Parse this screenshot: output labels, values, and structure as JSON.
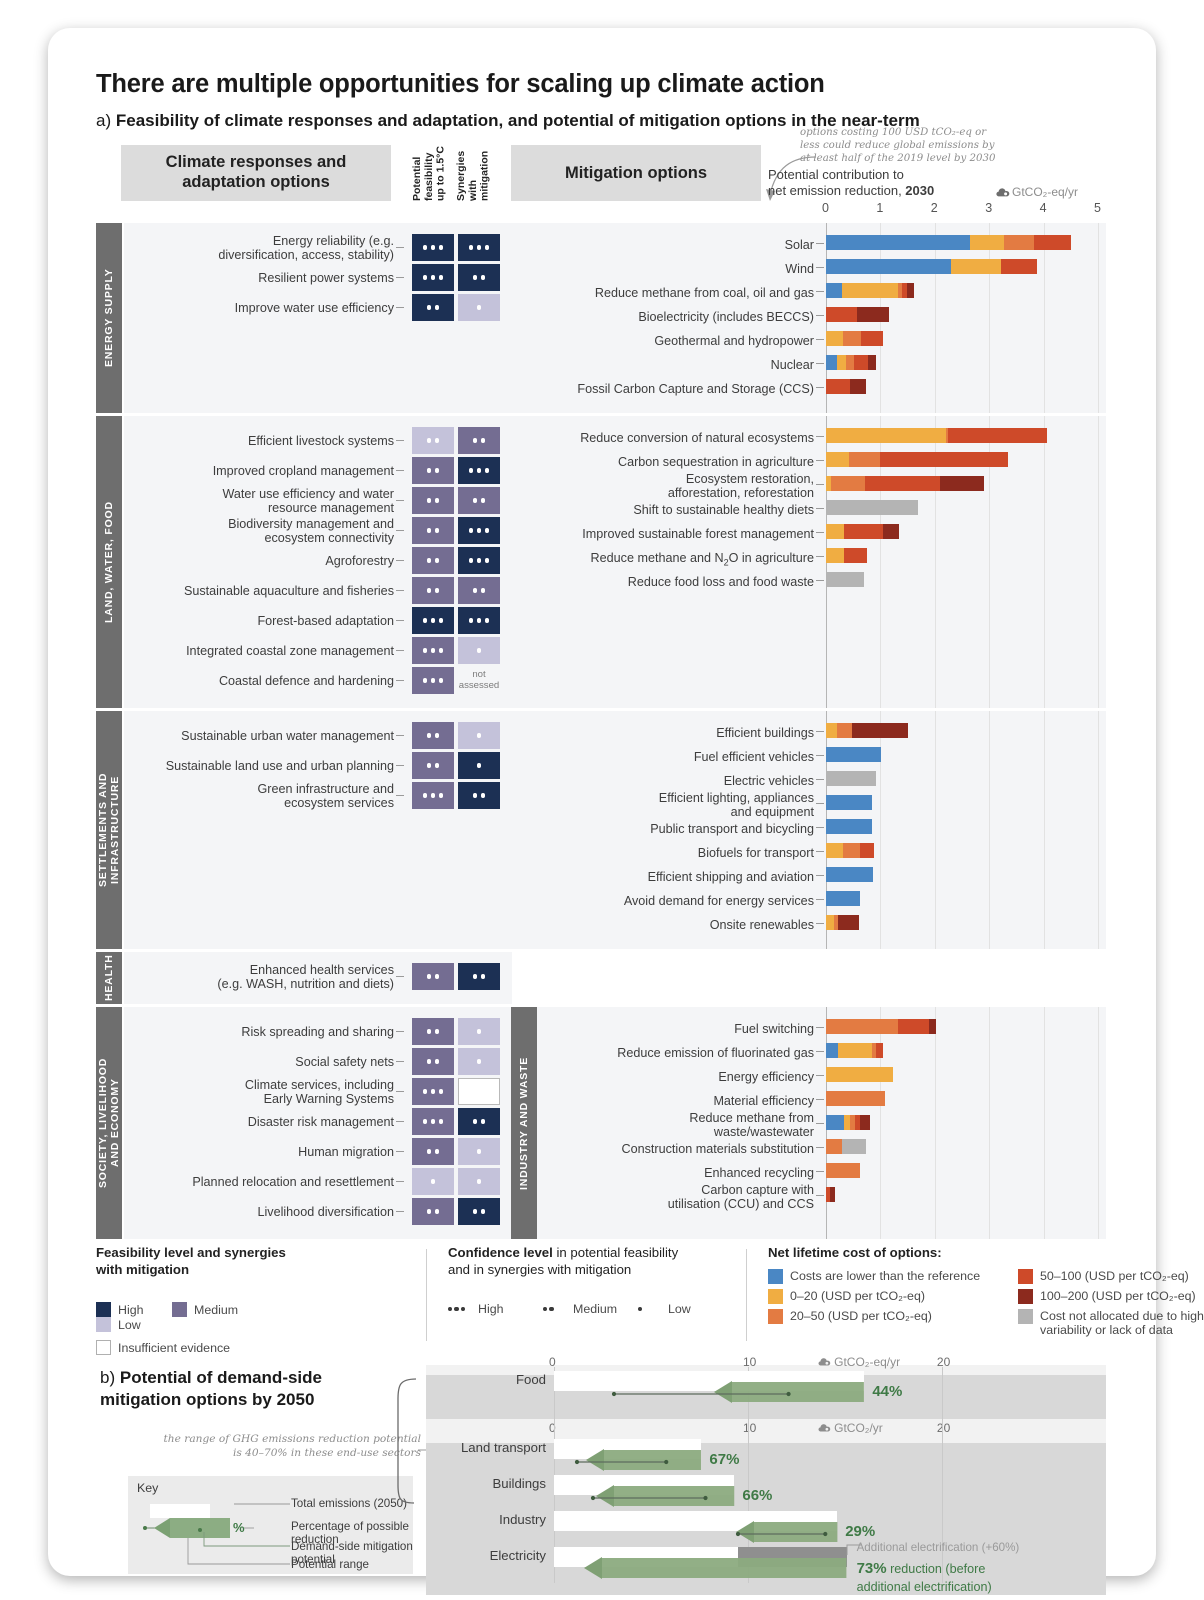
{
  "title": "There are multiple opportunities for scaling up climate action",
  "panel_a": {
    "letter": "a)",
    "subtitle": "Feasibility of climate responses and adaptation, and potential of mitigation options in the near-term",
    "header_left": "Climate responses and\nadaptation options",
    "col1": "Potential\nfeasibility\nup to 1.5°C",
    "col2": "Synergies\nwith\nmitigation",
    "header_mid": "Mitigation options",
    "callout_note": "options costing 100 USD tCO₂-eq or\nless could reduce global emissions by\nat least half of the 2019 level by 2030",
    "axis_title_line1": "Potential contribution to",
    "axis_title_line2a": "net emission reduction, ",
    "axis_title_line2b": "2030",
    "unit": "GtCO₂-eq/yr",
    "axis_ticks": [
      "0",
      "1",
      "2",
      "3",
      "4",
      "5"
    ],
    "axis_max": 5
  },
  "sections": [
    {
      "tab": "ENERGY SUPPLY",
      "adaptation": [
        {
          "label": "Energy reliability (e.g.\ndiversification, access, stability)",
          "feasibility": "high",
          "fdots": 3,
          "synergy": "high",
          "sdots": 3
        },
        {
          "label": "Resilient power systems",
          "feasibility": "high",
          "fdots": 3,
          "synergy": "high",
          "sdots": 2
        },
        {
          "label": "Improve water use efficiency",
          "feasibility": "high",
          "fdots": 2,
          "synergy": "low",
          "sdots": 1
        }
      ],
      "mitigation": [
        {
          "label": "Solar",
          "segments": [
            {
              "cost": "lower",
              "v": 2.65
            },
            {
              "cost": "0-20",
              "v": 0.62
            },
            {
              "cost": "20-50",
              "v": 0.55
            },
            {
              "cost": "50-100",
              "v": 0.68
            }
          ]
        },
        {
          "label": "Wind",
          "segments": [
            {
              "cost": "lower",
              "v": 2.3
            },
            {
              "cost": "0-20",
              "v": 0.92
            },
            {
              "cost": "20-50",
              "v": 0.0
            },
            {
              "cost": "50-100",
              "v": 0.66
            }
          ]
        },
        {
          "label": "Reduce methane from coal, oil and gas",
          "segments": [
            {
              "cost": "lower",
              "v": 0.3
            },
            {
              "cost": "0-20",
              "v": 1.02
            },
            {
              "cost": "20-50",
              "v": 0.07
            },
            {
              "cost": "50-100",
              "v": 0.1
            },
            {
              "cost": "100-200",
              "v": 0.12
            }
          ]
        },
        {
          "label": "Bioelectricity (includes BECCS)",
          "segments": [
            {
              "cost": "50-100",
              "v": 0.57
            },
            {
              "cost": "100-200",
              "v": 0.58
            }
          ]
        },
        {
          "label": "Geothermal and hydropower",
          "segments": [
            {
              "cost": "0-20",
              "v": 0.32
            },
            {
              "cost": "20-50",
              "v": 0.33
            },
            {
              "cost": "50-100",
              "v": 0.4
            }
          ]
        },
        {
          "label": "Nuclear",
          "segments": [
            {
              "cost": "lower",
              "v": 0.2
            },
            {
              "cost": "0-20",
              "v": 0.16
            },
            {
              "cost": "20-50",
              "v": 0.15
            },
            {
              "cost": "50-100",
              "v": 0.27
            },
            {
              "cost": "100-200",
              "v": 0.14
            }
          ]
        },
        {
          "label": "Fossil Carbon Capture and Storage (CCS)",
          "segments": [
            {
              "cost": "50-100",
              "v": 0.45
            },
            {
              "cost": "100-200",
              "v": 0.28
            }
          ]
        }
      ]
    },
    {
      "tab": "LAND, WATER, FOOD",
      "adaptation": [
        {
          "label": "Efficient livestock systems",
          "feasibility": "low",
          "fdots": 2,
          "synergy": "medium",
          "sdots": 2
        },
        {
          "label": "Improved cropland management",
          "feasibility": "medium",
          "fdots": 2,
          "synergy": "high",
          "sdots": 3
        },
        {
          "label": "Water use efficiency and water\nresource management",
          "feasibility": "medium",
          "fdots": 2,
          "synergy": "medium",
          "sdots": 2
        },
        {
          "label": "Biodiversity management and\necosystem connectivity",
          "feasibility": "medium",
          "fdots": 2,
          "synergy": "high",
          "sdots": 3
        },
        {
          "label": "Agroforestry",
          "feasibility": "medium",
          "fdots": 2,
          "synergy": "high",
          "sdots": 3
        },
        {
          "label": "Sustainable aquaculture and fisheries",
          "feasibility": "medium",
          "fdots": 2,
          "synergy": "medium",
          "sdots": 2
        },
        {
          "label": "Forest-based adaptation",
          "feasibility": "high",
          "fdots": 3,
          "synergy": "high",
          "sdots": 3
        },
        {
          "label": "Integrated coastal zone management",
          "feasibility": "medium",
          "fdots": 3,
          "synergy": "low",
          "sdots": 1
        },
        {
          "label": "Coastal defence and hardening",
          "feasibility": "medium",
          "fdots": 3,
          "synergy": "not assessed",
          "sdots": 0
        }
      ],
      "mitigation": [
        {
          "label": "Reduce conversion of natural ecosystems",
          "segments": [
            {
              "cost": "0-20",
              "v": 2.2
            },
            {
              "cost": "20-50",
              "v": 0.05
            },
            {
              "cost": "50-100",
              "v": 1.82
            }
          ]
        },
        {
          "label": "Carbon sequestration in agriculture",
          "segments": [
            {
              "cost": "0-20",
              "v": 0.42
            },
            {
              "cost": "20-50",
              "v": 0.58
            },
            {
              "cost": "50-100",
              "v": 2.35
            }
          ]
        },
        {
          "label": "Ecosystem restoration,\nafforestation, reforestation",
          "segments": [
            {
              "cost": "0-20",
              "v": 0.1
            },
            {
              "cost": "20-50",
              "v": 0.62
            },
            {
              "cost": "50-100",
              "v": 1.38
            },
            {
              "cost": "100-200",
              "v": 0.8
            }
          ]
        },
        {
          "label": "Shift to sustainable healthy diets",
          "segments": [
            {
              "cost": "notallocated",
              "v": 1.7
            }
          ]
        },
        {
          "label": "Improved sustainable forest management",
          "segments": [
            {
              "cost": "0-20",
              "v": 0.33
            },
            {
              "cost": "50-100",
              "v": 0.72
            },
            {
              "cost": "100-200",
              "v": 0.3
            }
          ]
        },
        {
          "label": "Reduce methane and N₂O in agriculture",
          "segments": [
            {
              "cost": "0-20",
              "v": 0.34
            },
            {
              "cost": "50-100",
              "v": 0.42
            }
          ]
        },
        {
          "label": "Reduce food loss and food waste",
          "segments": [
            {
              "cost": "notallocated",
              "v": 0.7
            }
          ]
        }
      ]
    },
    {
      "tab": "SETTLEMENTS AND\nINFRASTRUCTURE",
      "adaptation": [
        {
          "label": "Sustainable urban water management",
          "feasibility": "medium",
          "fdots": 2,
          "synergy": "low",
          "sdots": 1
        },
        {
          "label": "Sustainable land use and urban planning",
          "feasibility": "medium",
          "fdots": 2,
          "synergy": "high",
          "sdots": 1
        },
        {
          "label": "Green infrastructure and\necosystem services",
          "feasibility": "medium",
          "fdots": 3,
          "synergy": "high",
          "sdots": 2
        }
      ],
      "mitigation": [
        {
          "label": "Efficient buildings",
          "segments": [
            {
              "cost": "0-20",
              "v": 0.2
            },
            {
              "cost": "20-50",
              "v": 0.28
            },
            {
              "cost": "100-200",
              "v": 1.03
            }
          ]
        },
        {
          "label": "Fuel efficient vehicles",
          "segments": [
            {
              "cost": "lower",
              "v": 1.02
            }
          ]
        },
        {
          "label": "Electric vehicles",
          "segments": [
            {
              "cost": "notallocated",
              "v": 0.92
            }
          ]
        },
        {
          "label": "Efficient lighting, appliances\nand equipment",
          "segments": [
            {
              "cost": "lower",
              "v": 0.85
            }
          ]
        },
        {
          "label": "Public transport and bicycling",
          "segments": [
            {
              "cost": "lower",
              "v": 0.85
            }
          ]
        },
        {
          "label": "Biofuels for transport",
          "segments": [
            {
              "cost": "0-20",
              "v": 0.32
            },
            {
              "cost": "20-50",
              "v": 0.3
            },
            {
              "cost": "50-100",
              "v": 0.27
            }
          ]
        },
        {
          "label": "Efficient shipping and aviation",
          "segments": [
            {
              "cost": "lower",
              "v": 0.86
            }
          ]
        },
        {
          "label": "Avoid demand for energy services",
          "segments": [
            {
              "cost": "lower",
              "v": 0.62
            }
          ]
        },
        {
          "label": "Onsite renewables",
          "segments": [
            {
              "cost": "0-20",
              "v": 0.14
            },
            {
              "cost": "20-50",
              "v": 0.08
            },
            {
              "cost": "100-200",
              "v": 0.38
            }
          ]
        }
      ]
    },
    {
      "tab": "HEALTH",
      "adaptation": [
        {
          "label": "Enhanced health services\n(e.g. WASH, nutrition and diets)",
          "feasibility": "medium",
          "fdots": 2,
          "synergy": "high",
          "sdots": 2
        }
      ],
      "mitigation": []
    },
    {
      "tab": "SOCIETY, LIVELIHOOD\nAND ECONOMY",
      "adaptation": [
        {
          "label": "Risk spreading and sharing",
          "feasibility": "medium",
          "fdots": 2,
          "synergy": "low",
          "sdots": 1
        },
        {
          "label": "Social safety nets",
          "feasibility": "medium",
          "fdots": 2,
          "synergy": "low",
          "sdots": 1
        },
        {
          "label": "Climate services, including\nEarly Warning Systems",
          "feasibility": "medium",
          "fdots": 3,
          "synergy": "none",
          "sdots": 0
        },
        {
          "label": "Disaster risk management",
          "feasibility": "medium",
          "fdots": 3,
          "synergy": "high",
          "sdots": 2
        },
        {
          "label": "Human migration",
          "feasibility": "medium",
          "fdots": 2,
          "synergy": "low",
          "sdots": 1
        },
        {
          "label": "Planned relocation and resettlement",
          "feasibility": "low",
          "fdots": 1,
          "synergy": "low",
          "sdots": 1
        },
        {
          "label": "Livelihood diversification",
          "feasibility": "medium",
          "fdots": 2,
          "synergy": "high",
          "sdots": 2
        }
      ],
      "mitigation_tab": "INDUSTRY AND WASTE",
      "mitigation": [
        {
          "label": "Fuel switching",
          "segments": [
            {
              "cost": "20-50",
              "v": 1.32
            },
            {
              "cost": "50-100",
              "v": 0.58
            },
            {
              "cost": "100-200",
              "v": 0.12
            }
          ]
        },
        {
          "label": "Reduce emission of fluorinated gas",
          "segments": [
            {
              "cost": "lower",
              "v": 0.22
            },
            {
              "cost": "0-20",
              "v": 0.62
            },
            {
              "cost": "20-50",
              "v": 0.08
            },
            {
              "cost": "50-100",
              "v": 0.13
            }
          ]
        },
        {
          "label": "Energy efficiency",
          "segments": [
            {
              "cost": "0-20",
              "v": 1.23
            }
          ]
        },
        {
          "label": "Material efficiency",
          "segments": [
            {
              "cost": "20-50",
              "v": 1.08
            }
          ]
        },
        {
          "label": "Reduce methane from\nwaste/wastewater",
          "segments": [
            {
              "cost": "lower",
              "v": 0.33
            },
            {
              "cost": "0-20",
              "v": 0.12
            },
            {
              "cost": "20-50",
              "v": 0.08
            },
            {
              "cost": "50-100",
              "v": 0.1
            },
            {
              "cost": "100-200",
              "v": 0.18
            }
          ]
        },
        {
          "label": "Construction materials substitution",
          "segments": [
            {
              "cost": "20-50",
              "v": 0.3
            },
            {
              "cost": "notallocated",
              "v": 0.43
            }
          ]
        },
        {
          "label": "Enhanced recycling",
          "segments": [
            {
              "cost": "20-50",
              "v": 0.62
            }
          ]
        },
        {
          "label": "Carbon capture with\nutilisation (CCU) and CCS",
          "segments": [
            {
              "cost": "50-100",
              "v": 0.08
            },
            {
              "cost": "100-200",
              "v": 0.08
            }
          ]
        }
      ]
    }
  ],
  "legend": {
    "feasibility_title_b": "Feasibility level and synergies",
    "feasibility_title_2": "with mitigation",
    "feas_items": [
      {
        "label": "High",
        "color": "#1c3054"
      },
      {
        "label": "Medium",
        "color": "#746d92"
      },
      {
        "label": "Low",
        "color": "#c4c2da"
      }
    ],
    "insufficient": "Insufficient evidence",
    "confidence_title_b": "Confidence level",
    "confidence_title_n": " in potential feasibility",
    "confidence_title_2": "and in synergies with mitigation",
    "conf_items": [
      {
        "label": "High",
        "dots": 3
      },
      {
        "label": "Medium",
        "dots": 2
      },
      {
        "label": "Low",
        "dots": 1
      }
    ],
    "cost_title": "Net lifetime cost of options:",
    "cost_items_left": [
      {
        "label": "Costs are lower than the reference",
        "color": "#4a87c4"
      },
      {
        "label": "0–20 (USD per tCO₂-eq)",
        "color": "#f0ad42"
      },
      {
        "label": "20–50 (USD per tCO₂-eq)",
        "color": "#e37b42"
      }
    ],
    "cost_items_right": [
      {
        "label": "50–100 (USD per tCO₂-eq)",
        "color": "#ce4a29"
      },
      {
        "label": "100–200 (USD per tCO₂-eq)",
        "color": "#8c2a1e"
      },
      {
        "label": "Cost not allocated due to high\nvariability or lack of data",
        "color": "#b4b4b4"
      }
    ]
  },
  "panel_b": {
    "letter": "b)",
    "title": "Potential of demand-side\nmitigation options by 2050",
    "note": "the range of GHG emissions\nreduction potential is 40–70%\nin these end-use sectors",
    "key_title": "Key",
    "key_items": [
      "Total emissions (2050)",
      "Percentage of possible reduction",
      "Demand-side mitigation potential",
      "Potential range"
    ],
    "key_pct_symbol": "%",
    "axis1_ticks": [
      "0",
      "10",
      "20"
    ],
    "axis1_unit": "GtCO₂-eq/yr",
    "axis2_unit": "GtCO₂/yr",
    "rows": [
      {
        "label": "Food",
        "total": 16.0,
        "reduction_pct": "44%",
        "potential_start": 9.2,
        "potential_end": 16.0,
        "range_low": 3.1,
        "range_high": 12.1
      },
      {
        "label": "Land transport",
        "total": 7.6,
        "reduction_pct": "67%",
        "potential_start": 2.6,
        "potential_end": 7.6,
        "range_low": 1.2,
        "range_high": 5.8
      },
      {
        "label": "Buildings",
        "total": 9.3,
        "reduction_pct": "66%",
        "potential_start": 3.1,
        "potential_end": 9.3,
        "range_low": 2.0,
        "range_high": 7.8
      },
      {
        "label": "Industry",
        "total": 14.6,
        "reduction_pct": "29%",
        "potential_start": 10.3,
        "potential_end": 14.6,
        "range_low": 9.5,
        "range_high": 14.0
      },
      {
        "label": "Electricity",
        "total": 9.5,
        "reduction_pct": "73%",
        "potential_start": 2.5,
        "potential_end": 9.5,
        "range_low": 0,
        "range_high": 0
      }
    ],
    "electricity_note": "Additional electrification (+60%)",
    "electricity_reduction_pct": "73%",
    "electricity_reduction_text": " reduction (before\nadditional electrification)",
    "axis_max": 23.2
  }
}
